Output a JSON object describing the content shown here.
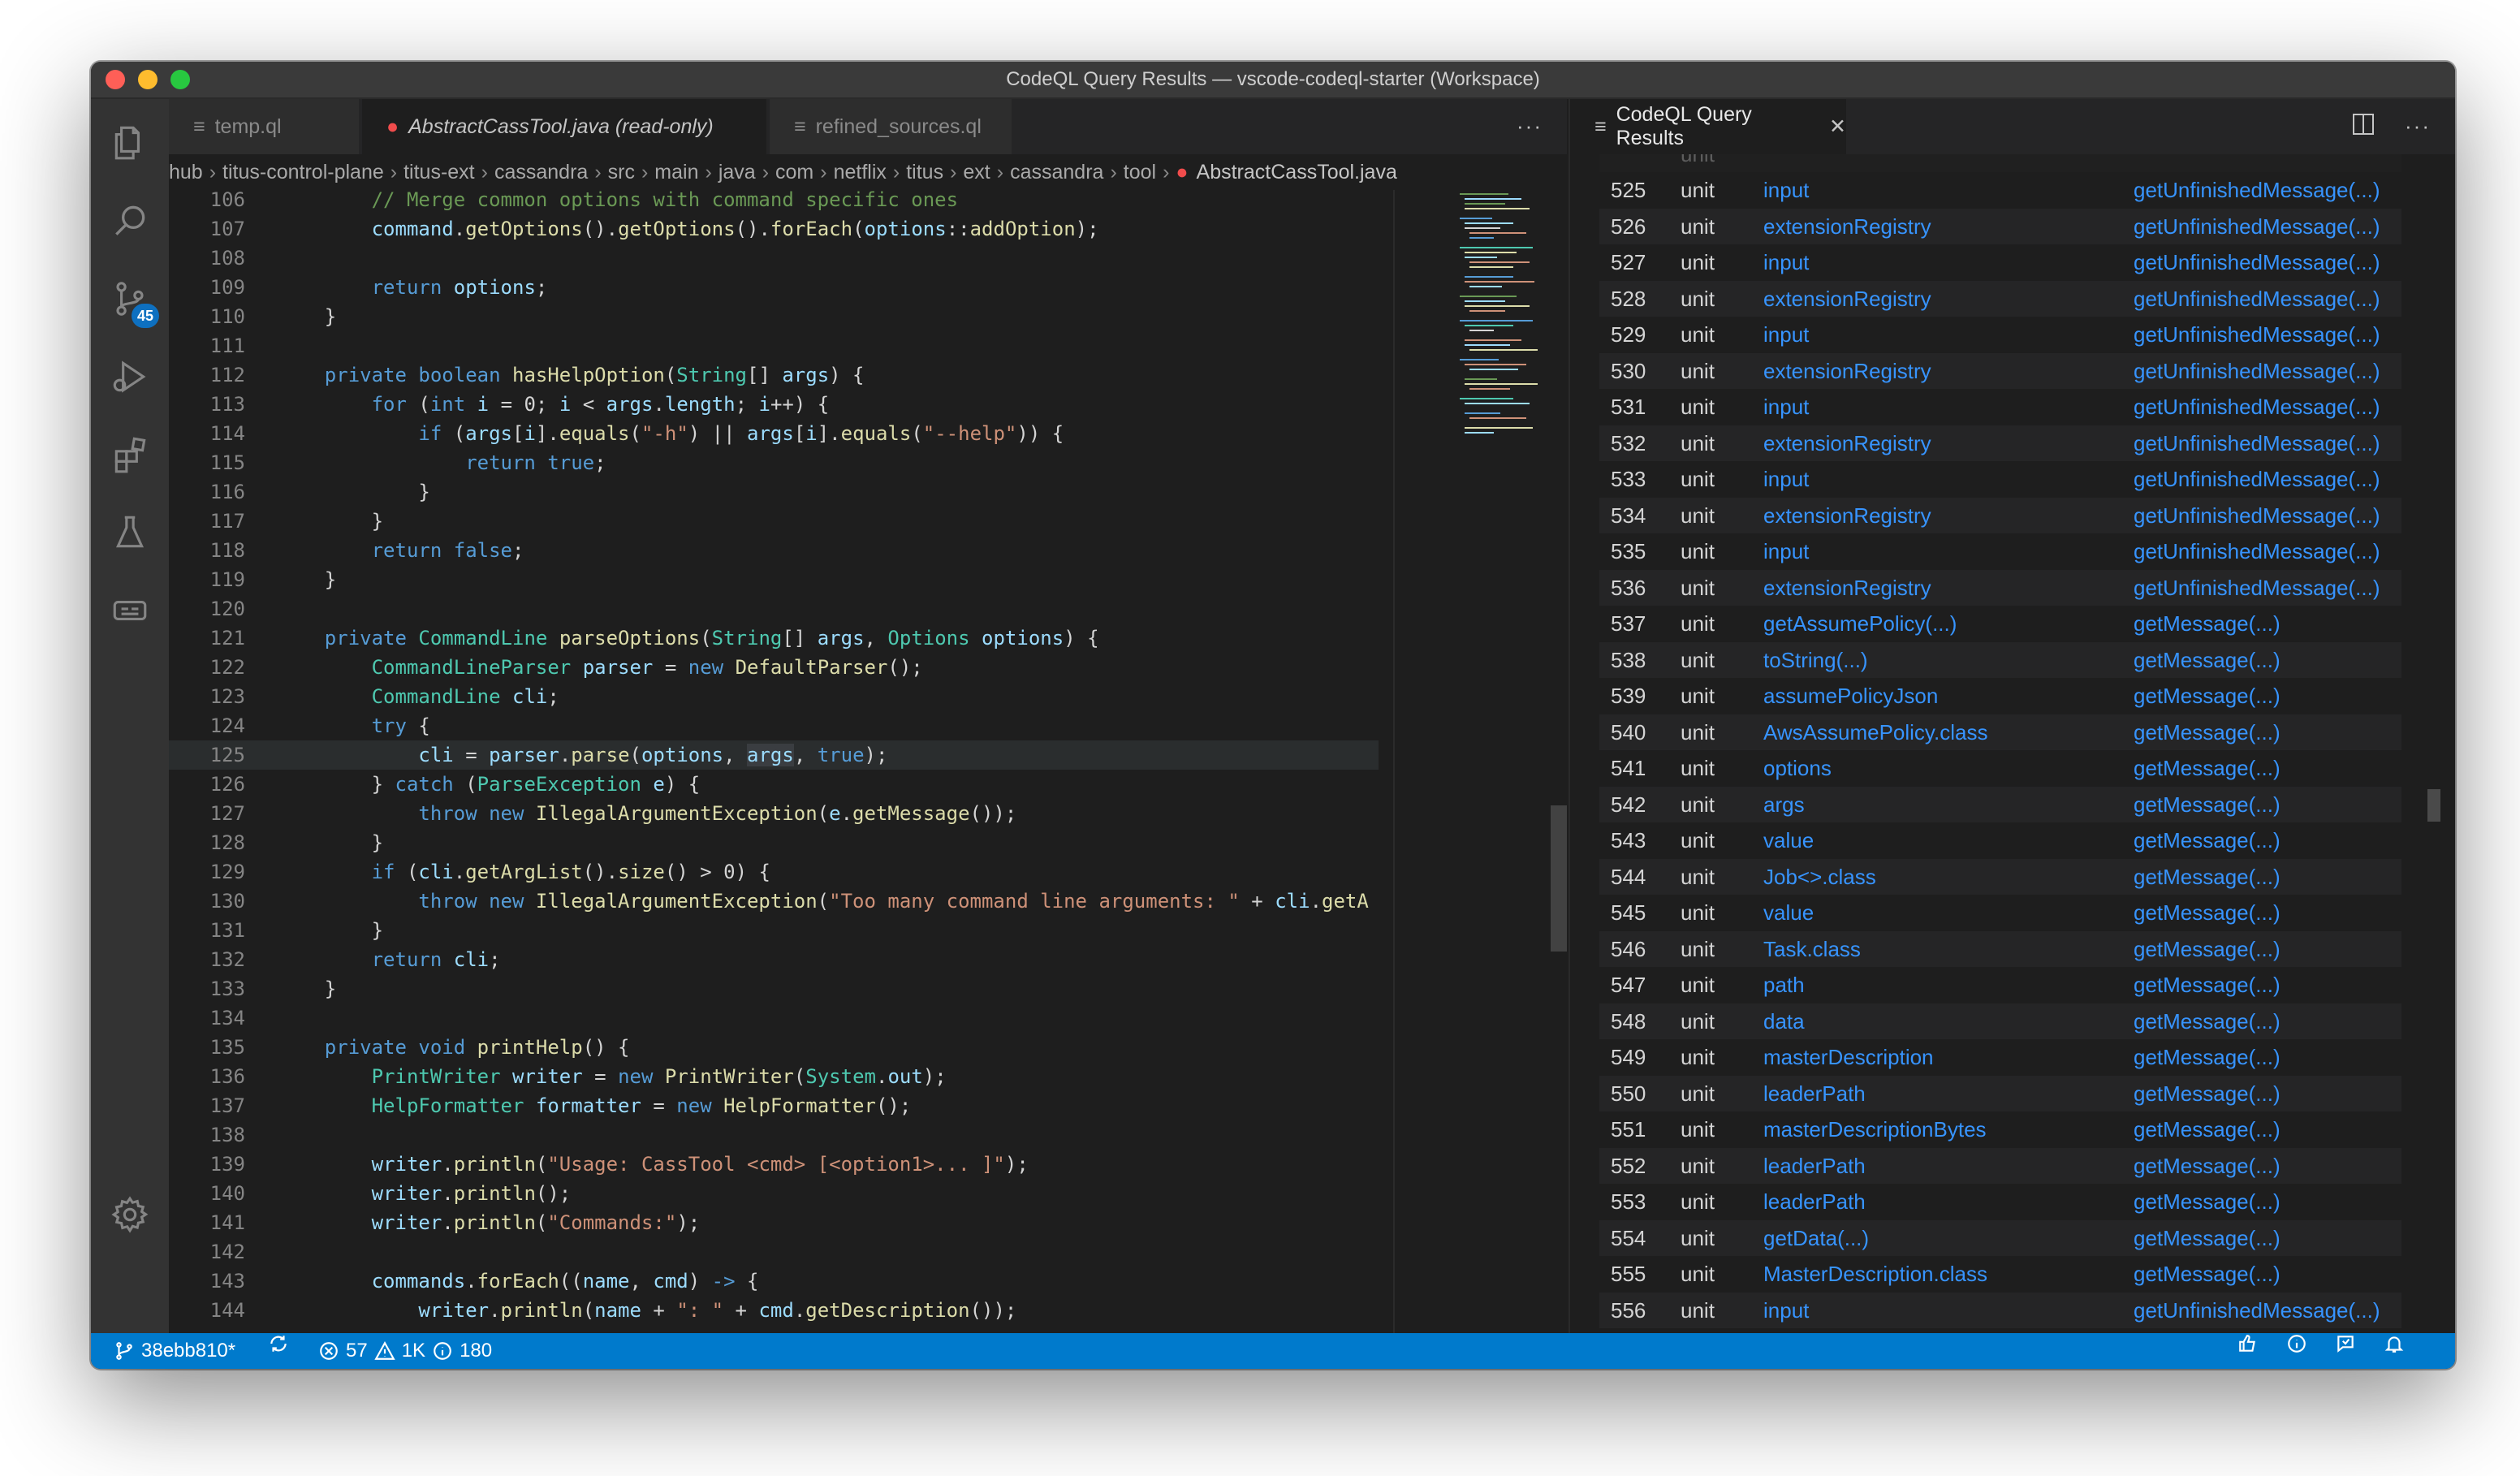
{
  "window": {
    "title": "CodeQL Query Results — vscode-codeql-starter (Workspace)"
  },
  "activity_bar": {
    "scm_badge": "45"
  },
  "editor": {
    "tabs": [
      {
        "label": "temp.ql",
        "icon": "list-icon"
      },
      {
        "label": "AbstractCassTool.java (read-only)",
        "icon": "error-icon"
      },
      {
        "label": "refined_sources.ql",
        "icon": "list-icon"
      }
    ],
    "more_label": "···",
    "breadcrumb": [
      "hub",
      "titus-control-plane",
      "titus-ext",
      "cassandra",
      "src",
      "main",
      "java",
      "com",
      "netflix",
      "titus",
      "ext",
      "cassandra",
      "tool",
      "AbstractCassTool.java"
    ],
    "line_numbers": [
      "106",
      "107",
      "108",
      "109",
      "110",
      "111",
      "112",
      "113",
      "114",
      "115",
      "116",
      "117",
      "118",
      "119",
      "120",
      "121",
      "122",
      "123",
      "124",
      "125",
      "126",
      "127",
      "128",
      "129",
      "130",
      "131",
      "132",
      "133",
      "134",
      "135",
      "136",
      "137",
      "138",
      "139",
      "140",
      "141",
      "142",
      "143",
      "144"
    ]
  },
  "results_panel": {
    "tab_label": "CodeQL Query Results",
    "close_label": "✕",
    "more_label": "···",
    "rows": [
      {
        "n": "525",
        "u": "unit",
        "a": "input",
        "m": "getUnfinishedMessage(...)"
      },
      {
        "n": "526",
        "u": "unit",
        "a": "extensionRegistry",
        "m": "getUnfinishedMessage(...)"
      },
      {
        "n": "527",
        "u": "unit",
        "a": "input",
        "m": "getUnfinishedMessage(...)"
      },
      {
        "n": "528",
        "u": "unit",
        "a": "extensionRegistry",
        "m": "getUnfinishedMessage(...)"
      },
      {
        "n": "529",
        "u": "unit",
        "a": "input",
        "m": "getUnfinishedMessage(...)"
      },
      {
        "n": "530",
        "u": "unit",
        "a": "extensionRegistry",
        "m": "getUnfinishedMessage(...)"
      },
      {
        "n": "531",
        "u": "unit",
        "a": "input",
        "m": "getUnfinishedMessage(...)"
      },
      {
        "n": "532",
        "u": "unit",
        "a": "extensionRegistry",
        "m": "getUnfinishedMessage(...)"
      },
      {
        "n": "533",
        "u": "unit",
        "a": "input",
        "m": "getUnfinishedMessage(...)"
      },
      {
        "n": "534",
        "u": "unit",
        "a": "extensionRegistry",
        "m": "getUnfinishedMessage(...)"
      },
      {
        "n": "535",
        "u": "unit",
        "a": "input",
        "m": "getUnfinishedMessage(...)"
      },
      {
        "n": "536",
        "u": "unit",
        "a": "extensionRegistry",
        "m": "getUnfinishedMessage(...)"
      },
      {
        "n": "537",
        "u": "unit",
        "a": "getAssumePolicy(...)",
        "m": "getMessage(...)"
      },
      {
        "n": "538",
        "u": "unit",
        "a": "toString(...)",
        "m": "getMessage(...)"
      },
      {
        "n": "539",
        "u": "unit",
        "a": "assumePolicyJson",
        "m": "getMessage(...)"
      },
      {
        "n": "540",
        "u": "unit",
        "a": "AwsAssumePolicy.class",
        "m": "getMessage(...)"
      },
      {
        "n": "541",
        "u": "unit",
        "a": "options",
        "m": "getMessage(...)"
      },
      {
        "n": "542",
        "u": "unit",
        "a": "args",
        "m": "getMessage(...)"
      },
      {
        "n": "543",
        "u": "unit",
        "a": "value",
        "m": "getMessage(...)"
      },
      {
        "n": "544",
        "u": "unit",
        "a": "Job<>.class",
        "m": "getMessage(...)"
      },
      {
        "n": "545",
        "u": "unit",
        "a": "value",
        "m": "getMessage(...)"
      },
      {
        "n": "546",
        "u": "unit",
        "a": "Task.class",
        "m": "getMessage(...)"
      },
      {
        "n": "547",
        "u": "unit",
        "a": "path",
        "m": "getMessage(...)"
      },
      {
        "n": "548",
        "u": "unit",
        "a": "data",
        "m": "getMessage(...)"
      },
      {
        "n": "549",
        "u": "unit",
        "a": "masterDescription",
        "m": "getMessage(...)"
      },
      {
        "n": "550",
        "u": "unit",
        "a": "leaderPath",
        "m": "getMessage(...)"
      },
      {
        "n": "551",
        "u": "unit",
        "a": "masterDescriptionBytes",
        "m": "getMessage(...)"
      },
      {
        "n": "552",
        "u": "unit",
        "a": "leaderPath",
        "m": "getMessage(...)"
      },
      {
        "n": "553",
        "u": "unit",
        "a": "leaderPath",
        "m": "getMessage(...)"
      },
      {
        "n": "554",
        "u": "unit",
        "a": "getData(...)",
        "m": "getMessage(...)"
      },
      {
        "n": "555",
        "u": "unit",
        "a": "MasterDescription.class",
        "m": "getMessage(...)"
      },
      {
        "n": "556",
        "u": "unit",
        "a": "input",
        "m": "getUnfinishedMessage(...)"
      }
    ]
  },
  "status_bar": {
    "branch": "38ebb810*",
    "errors": "57",
    "warnings": "1K",
    "infos": "180"
  },
  "colors": {
    "accent": "#007acc",
    "link": "#3794ff",
    "error": "#f14c4c"
  }
}
